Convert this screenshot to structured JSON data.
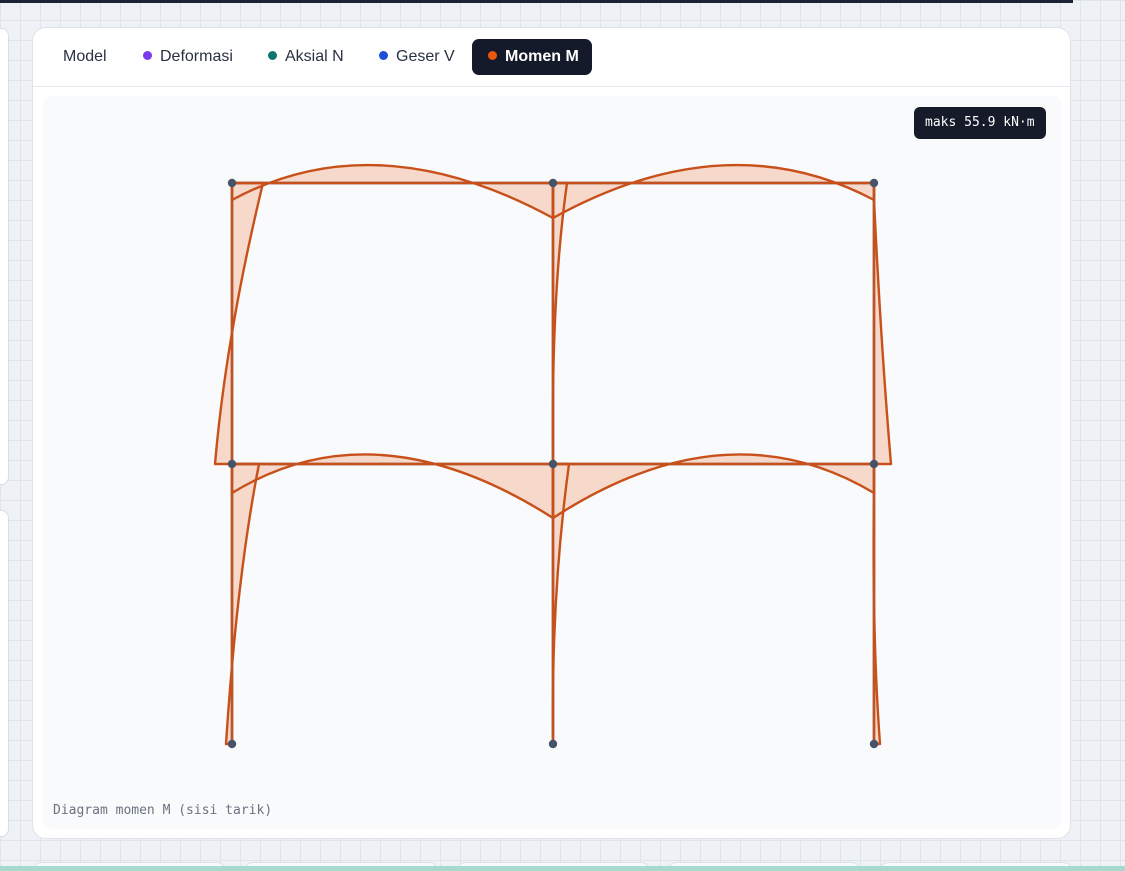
{
  "tabs": [
    {
      "label": "Model",
      "dot": null,
      "active": false
    },
    {
      "label": "Deformasi",
      "dot": "#7c3aed",
      "active": false
    },
    {
      "label": "Aksial N",
      "dot": "#0f766e",
      "active": false
    },
    {
      "label": "Geser V",
      "dot": "#1d4ed8",
      "active": false
    },
    {
      "label": "Momen M",
      "dot": "#ea580c",
      "active": true
    }
  ],
  "diagram": {
    "max_badge": "maks 55.9 kN·m",
    "caption": "Diagram momen M (sisi tarik)",
    "colors": {
      "frame": "#9aa1ab",
      "node": "#475467",
      "moment_line": "#c8501a",
      "moment_fill": "#f6d9ca"
    }
  }
}
